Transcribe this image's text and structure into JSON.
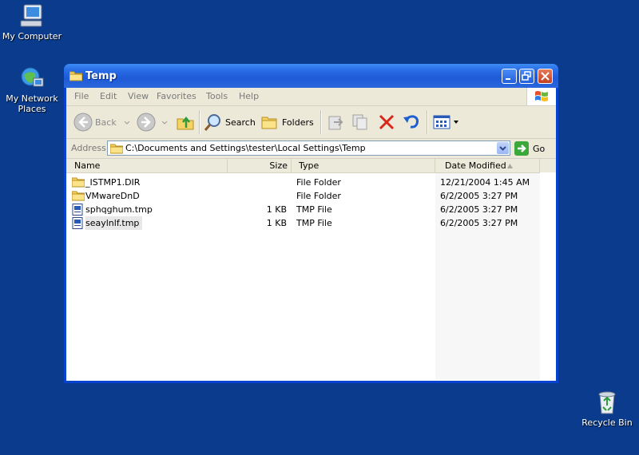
{
  "desktop": {
    "icons": [
      {
        "label_line1": "My Computer",
        "label_line2": ""
      },
      {
        "label_line1": "My Network",
        "label_line2": "Places"
      },
      {
        "label_line1": "Recycle Bin",
        "label_line2": ""
      }
    ]
  },
  "window": {
    "title": "Temp",
    "menu": [
      "File",
      "Edit",
      "View",
      "Favorites",
      "Tools",
      "Help"
    ],
    "toolbar": {
      "back": "Back",
      "search": "Search",
      "folders": "Folders"
    },
    "address": {
      "label": "Address",
      "value": "C:\\Documents and Settings\\tester\\Local Settings\\Temp",
      "go": "Go"
    },
    "columns": {
      "name": "Name",
      "size": "Size",
      "type": "Type",
      "date": "Date Modified"
    },
    "files": [
      {
        "name": "_ISTMP1.DIR",
        "size": "",
        "type": "File Folder",
        "date": "12/21/2004 1:45 AM",
        "icon": "folder-icon"
      },
      {
        "name": "VMwareDnD",
        "size": "",
        "type": "File Folder",
        "date": "6/2/2005 3:27 PM",
        "icon": "folder-icon"
      },
      {
        "name": "sphqghum.tmp",
        "size": "1 KB",
        "type": "TMP File",
        "date": "6/2/2005 3:27 PM",
        "icon": "tmp-file-icon"
      },
      {
        "name": "seaylnlf.tmp",
        "size": "1 KB",
        "type": "TMP File",
        "date": "6/2/2005 3:27 PM",
        "icon": "tmp-file-icon"
      }
    ]
  },
  "colors": {
    "desktop": "#0a3b8c",
    "titlebar": "#2a6ee6",
    "chrome": "#ece9d8"
  }
}
